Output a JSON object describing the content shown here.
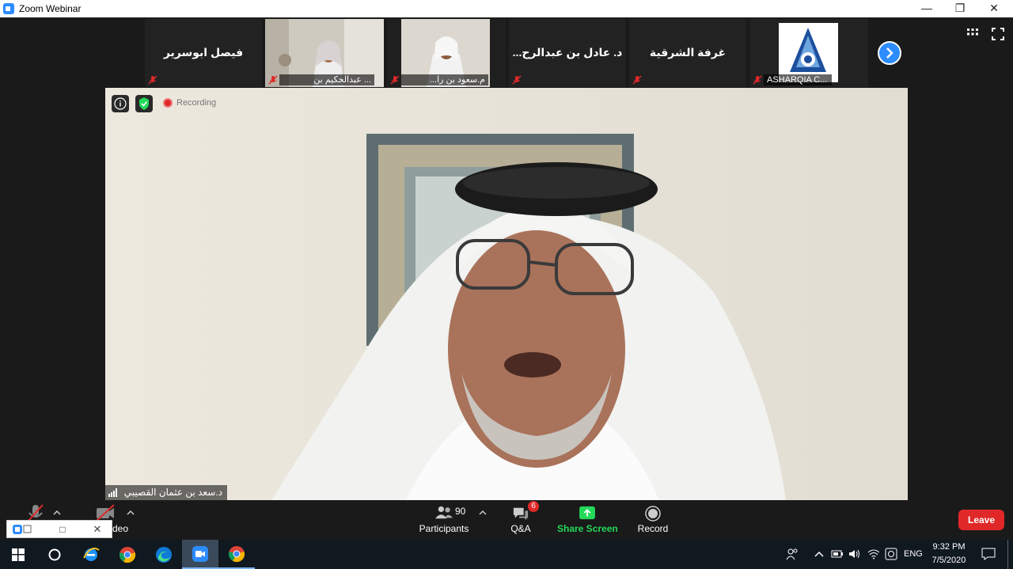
{
  "window": {
    "title": "Zoom Webinar"
  },
  "thumbnails": [
    {
      "name": "فيصل ابوسرير",
      "label": ""
    },
    {
      "name": "",
      "label": "... عبدالحكيم بن"
    },
    {
      "name": "",
      "label": "م.سعود بن را..."
    },
    {
      "name": "د. عادل بن عبدالرح...",
      "label": ""
    },
    {
      "name": "غرفة الشرقية",
      "label": ""
    },
    {
      "name": "",
      "label": "ASHARQIA C..."
    }
  ],
  "main": {
    "recording_label": "Recording",
    "speaker_name": "د.سعد بن عثمان القصيبي"
  },
  "toolbar": {
    "video_label": "deo",
    "participants_label": "Participants",
    "participants_count": "90",
    "qa_label": "Q&A",
    "qa_badge": "6",
    "share_label": "Share Screen",
    "record_label": "Record",
    "leave_label": "Leave"
  },
  "taskbar": {
    "lang": "ENG",
    "time": "9:32 PM",
    "date": "7/5/2020"
  },
  "colors": {
    "accent": "#2d8cff",
    "share": "#23d959",
    "leave": "#e02828",
    "mute_red": "#e02828"
  }
}
